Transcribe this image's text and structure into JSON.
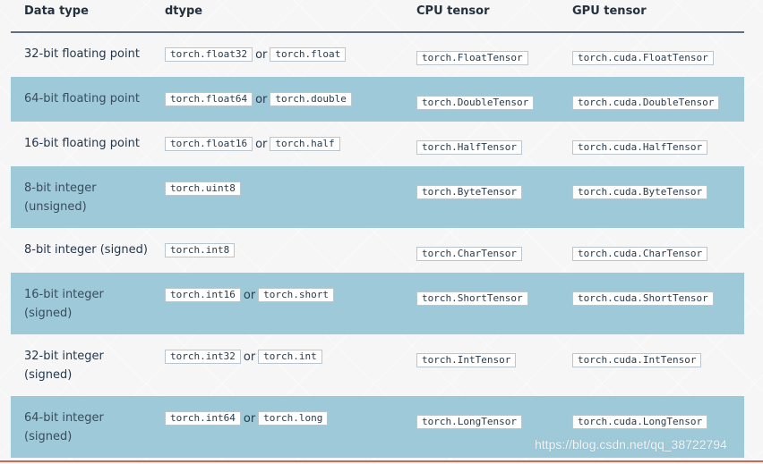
{
  "headers": {
    "data_type": "Data type",
    "dtype": "dtype",
    "cpu_tensor": "CPU tensor",
    "gpu_tensor": "GPU tensor"
  },
  "rows": [
    {
      "type_lines": [
        "32-bit floating point"
      ],
      "dtype": [
        "torch.float32",
        "torch.float"
      ],
      "cpu": "torch.FloatTensor",
      "gpu": "torch.cuda.FloatTensor",
      "shaded": false
    },
    {
      "type_lines": [
        "64-bit floating point"
      ],
      "dtype": [
        "torch.float64",
        "torch.double"
      ],
      "cpu": "torch.DoubleTensor",
      "gpu": "torch.cuda.DoubleTensor",
      "shaded": true
    },
    {
      "type_lines": [
        "16-bit floating point"
      ],
      "dtype": [
        "torch.float16",
        "torch.half"
      ],
      "cpu": "torch.HalfTensor",
      "gpu": "torch.cuda.HalfTensor",
      "shaded": false
    },
    {
      "type_lines": [
        "8-bit integer",
        "(unsigned)"
      ],
      "dtype": [
        "torch.uint8"
      ],
      "cpu": "torch.ByteTensor",
      "gpu": "torch.cuda.ByteTensor",
      "shaded": true
    },
    {
      "type_lines": [
        "8-bit integer (signed)"
      ],
      "dtype": [
        "torch.int8"
      ],
      "cpu": "torch.CharTensor",
      "gpu": "torch.cuda.CharTensor",
      "shaded": false
    },
    {
      "type_lines": [
        "16-bit integer",
        "(signed)"
      ],
      "dtype": [
        "torch.int16",
        "torch.short"
      ],
      "cpu": "torch.ShortTensor",
      "gpu": "torch.cuda.ShortTensor",
      "shaded": true
    },
    {
      "type_lines": [
        "32-bit integer",
        "(signed)"
      ],
      "dtype": [
        "torch.int32",
        "torch.int"
      ],
      "cpu": "torch.IntTensor",
      "gpu": "torch.cuda.IntTensor",
      "shaded": false
    },
    {
      "type_lines": [
        "64-bit integer",
        "(signed)"
      ],
      "dtype": [
        "torch.int64",
        "torch.long"
      ],
      "cpu": "torch.LongTensor",
      "gpu": "torch.cuda.LongTensor",
      "shaded": true
    }
  ],
  "or_label": "or",
  "watermark": "https://blog.csdn.net/qq_38722794"
}
